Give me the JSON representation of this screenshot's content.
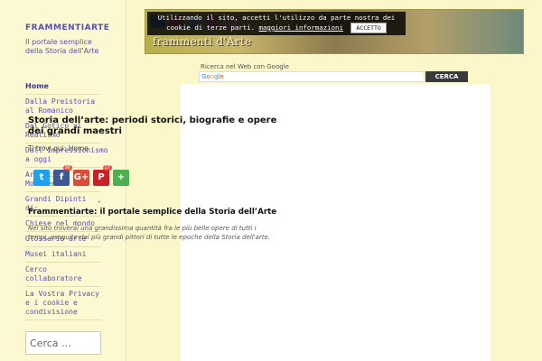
{
  "site": {
    "title": "FRAMMENTIARTE",
    "tagline": "Il portale semplice della Storia dell'Arte"
  },
  "nav": {
    "items": [
      {
        "label": "Home",
        "active": true,
        "has_children": false
      },
      {
        "label": "Dalla Preistoria al Romanico",
        "active": false,
        "has_children": false
      },
      {
        "label": "Dal Gotico al Realismo",
        "active": false,
        "has_children": false
      },
      {
        "label": "Dall'Impressionismo a oggi",
        "active": false,
        "has_children": false
      },
      {
        "label": "Artisti e Movimenti",
        "active": false,
        "has_children": true
      },
      {
        "label": "Grandi Dipinti di:",
        "active": false,
        "has_children": true
      },
      {
        "label": "Chiese nel mondo",
        "active": false,
        "has_children": false
      },
      {
        "label": "Glossario arte",
        "active": false,
        "has_children": false
      },
      {
        "label": "Musei italiani",
        "active": false,
        "has_children": false
      },
      {
        "label": "Cerco collaboratore",
        "active": false,
        "has_children": false
      },
      {
        "label": "La Vostra Privacy e i cookie e condivisione",
        "active": false,
        "has_children": false
      }
    ],
    "chevron_icon": "chevron-down-icon"
  },
  "sidebar_search": {
    "placeholder": "Cerca …"
  },
  "banner": {
    "logo_text": "frammenti d'Arte"
  },
  "cookie_notice": {
    "text": "Utilizzando il sito, accetti l'utilizzo da parte nostra dei cookie di terze parti.",
    "more_link": "maggiori informazioni",
    "accept_label": "ACCETTO"
  },
  "google_search": {
    "label": "Ricerca nel Web con Google",
    "brand": [
      "G",
      "o",
      "o",
      "g",
      "l",
      "e"
    ],
    "button_label": "CERCA"
  },
  "article": {
    "title": "Storia dell’arte: periodi storici, biografie e opere dei grandi maestri",
    "breadcrumb_prefix": "Ti trovi qui:",
    "breadcrumb_home": "Home",
    "heading": "Frammentiarte: il portale semplice della Storia dell’Arte",
    "intro": "Nel sito troverai una grandissima quantità fra le più belle opere di tutti i tempi, eseguite dai più grandi pittori di tutte le epoche della Storia dell'arte."
  },
  "share_buttons": [
    {
      "name": "twitter",
      "icon": "twitter-icon",
      "glyph": "t",
      "color": "#1da1f2",
      "count": ""
    },
    {
      "name": "facebook",
      "icon": "facebook-icon",
      "glyph": "f",
      "color": "#3b5998",
      "count": "98"
    },
    {
      "name": "google-plus",
      "icon": "google-plus-icon",
      "glyph": "G+",
      "color": "#dd4b39",
      "count": ""
    },
    {
      "name": "pinterest",
      "icon": "pinterest-icon",
      "glyph": "P",
      "color": "#cb2027",
      "count": "27"
    },
    {
      "name": "more",
      "icon": "more-share-icon",
      "glyph": "+",
      "color": "#4caf50",
      "count": ""
    }
  ]
}
